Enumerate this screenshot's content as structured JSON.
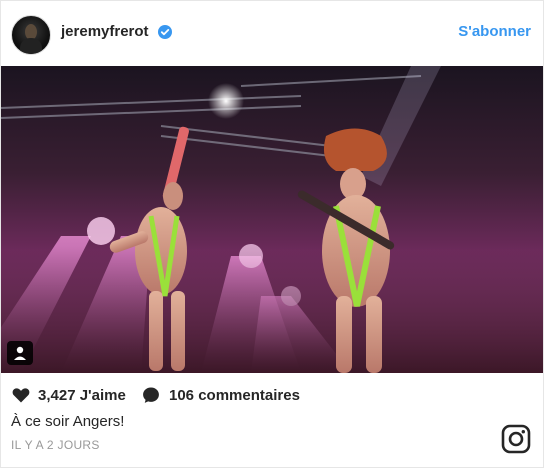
{
  "post": {
    "username": "jeremyfrerot",
    "follow_label": "S'abonner",
    "likes_text": "3,427 J'aime",
    "comments_text": "106 commentaires",
    "caption": "À ce soir Angers!",
    "timestamp": "IL Y A 2 JOURS"
  },
  "colors": {
    "follow_blue": "#3897f0",
    "verified_blue": "#3897f0",
    "text": "#262626",
    "muted": "#999999"
  },
  "icons": {
    "verified": "verified-badge-icon",
    "tag": "user-tag-icon",
    "like": "heart-icon",
    "comment": "comment-icon",
    "brand": "instagram-logo-icon"
  }
}
